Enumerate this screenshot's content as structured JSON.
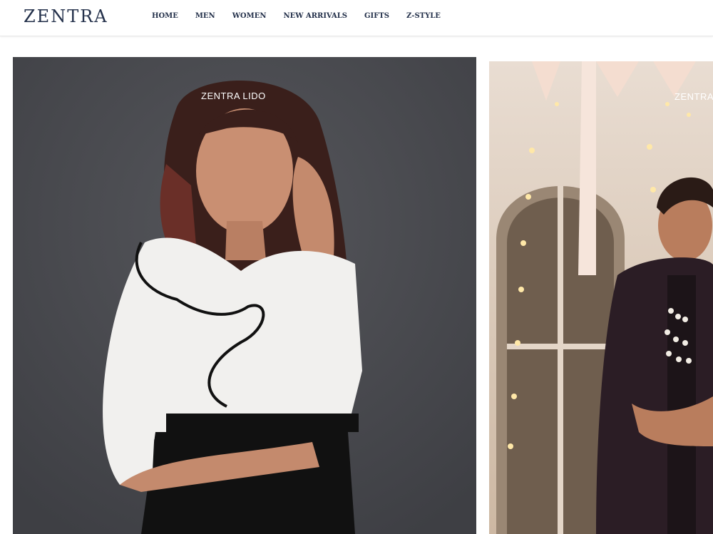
{
  "brand": {
    "logo": "ZENTRA"
  },
  "nav": {
    "items": [
      {
        "label": "HOME"
      },
      {
        "label": "MEN"
      },
      {
        "label": "WOMEN"
      },
      {
        "label": "NEW ARRIVALS"
      },
      {
        "label": "GIFTS"
      },
      {
        "label": "Z-STYLE"
      }
    ]
  },
  "banners": [
    {
      "label": "ZENTRA LIDO"
    },
    {
      "label": "ZENTRA"
    }
  ],
  "colors": {
    "brand_navy": "#23304a",
    "left_bg": "#4a4b50",
    "right_bg": "#efe4d8"
  }
}
